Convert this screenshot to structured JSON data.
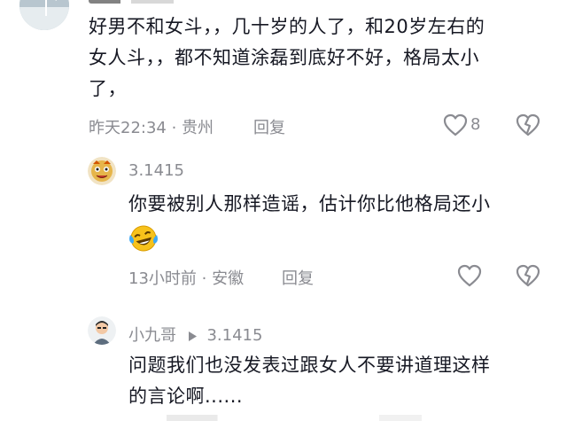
{
  "comment_main": {
    "text_lines": [
      "好男不和女斗，，几十岁的人了，和20岁左右的",
      "女人斗，，都不知道涂磊到底好不好，格局太小",
      "了，"
    ],
    "time": "昨天22:34",
    "location": "贵州",
    "reply_label": "回复",
    "like_count": "8"
  },
  "reply1": {
    "username": "3.1415",
    "text": "你要被别人那样造谣，估计你比他格局还小",
    "emoji": "laughing-crying-emoji",
    "time": "13小时前",
    "location": "安徽",
    "reply_label": "回复"
  },
  "reply2": {
    "username": "小九哥",
    "reply_to": "3.1415",
    "text_lines": [
      "问题我们也没发表过跟女人不要讲道理这样",
      "的言论啊......"
    ]
  },
  "icons": {
    "like": "heart-outline-icon",
    "dislike": "broken-heart-icon",
    "reply_arrow": "play-triangle-icon"
  },
  "colors": {
    "text": "#161823",
    "meta": "#8a8b91",
    "background": "#ffffff"
  }
}
